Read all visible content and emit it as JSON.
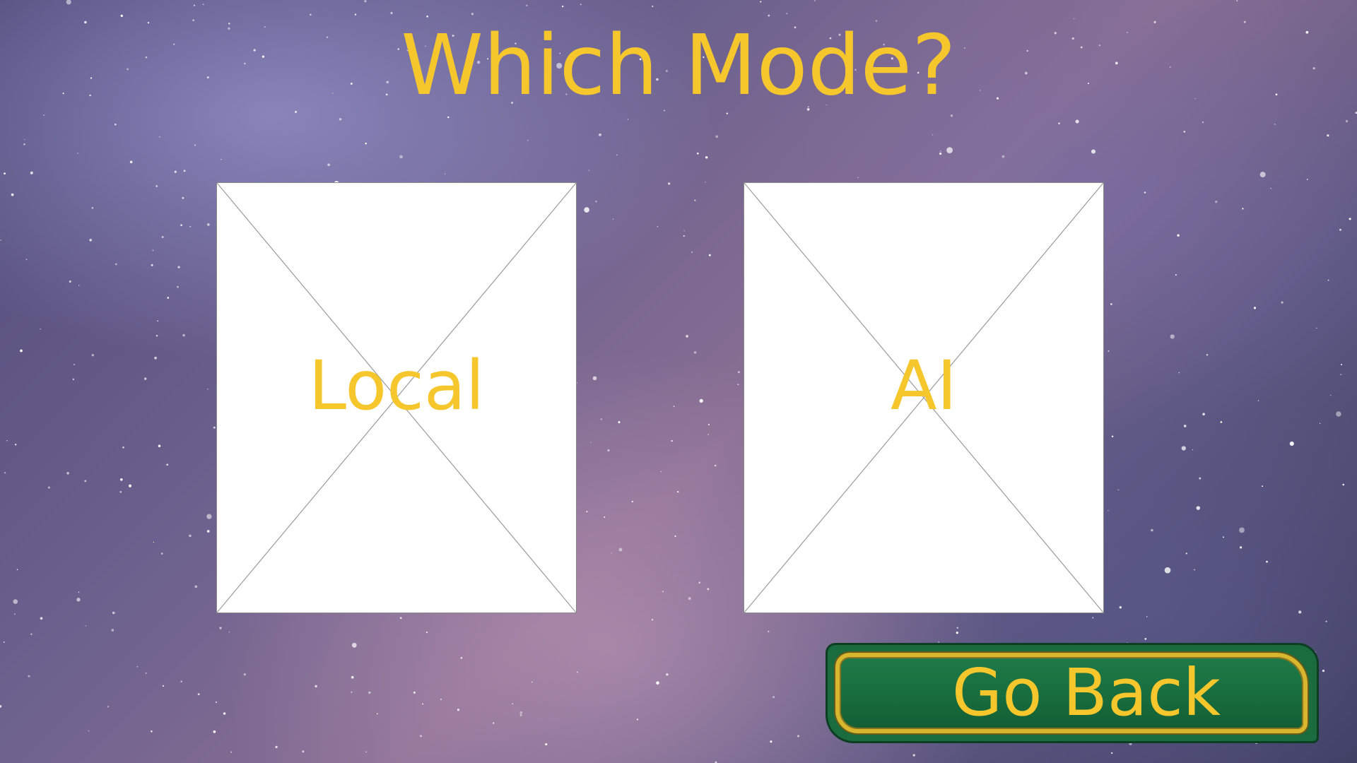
{
  "screen": {
    "title": "Which Mode?"
  },
  "modes": [
    {
      "label": "Local"
    },
    {
      "label": "AI"
    }
  ],
  "go_back": {
    "label": "Go Back"
  },
  "colors": {
    "text_accent": "#f6c72c",
    "button_green": "#1a6b3e",
    "button_gold_border": "#d8b62e",
    "card_background": "#ffffff"
  },
  "background": {
    "description_icon": "starry-night-sky"
  }
}
